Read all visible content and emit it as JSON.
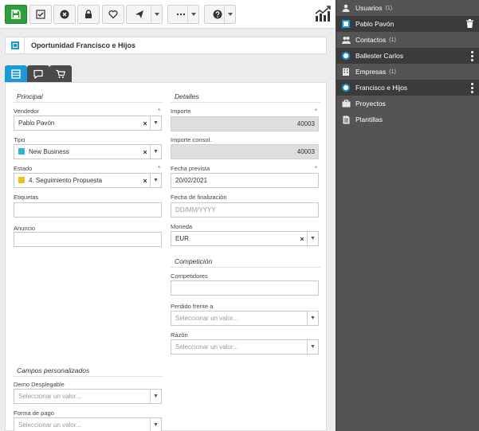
{
  "toolbar": {
    "buttons": [
      "save-icon",
      "check-icon",
      "cancel-circle-icon",
      "lock-icon",
      "heart-icon",
      "send-icon",
      "more-icon",
      "help-icon"
    ],
    "accent": "#2e9e3f"
  },
  "record": {
    "title": "Oportunidad Francisco e Hijos"
  },
  "tabs": [
    "form-icon",
    "comments-icon",
    "cart-icon"
  ],
  "form": {
    "principal": {
      "title": "Principal",
      "vendedor": {
        "label": "Vendedor",
        "value": "Pablo Pavón",
        "required": "*"
      },
      "tipo": {
        "label": "Tipo",
        "value": "New Business",
        "color": "#29b6d6"
      },
      "estado": {
        "label": "Estado",
        "value": "4. Seguimiento Propuesta",
        "color": "#e8c21a",
        "required": "*"
      },
      "etiquetas": {
        "label": "Etiquetas",
        "value": ""
      },
      "anuncio": {
        "label": "Anuncio",
        "value": ""
      }
    },
    "detalles": {
      "title": "Detalles",
      "importe": {
        "label": "Importe",
        "value": "40003",
        "required": "*"
      },
      "importe_consol": {
        "label": "Importe consol.",
        "value": "40003"
      },
      "fecha_prevista": {
        "label": "Fecha prevista",
        "value": "20/02/2021",
        "required": "*"
      },
      "fecha_finalizacion": {
        "label": "Fecha de finalización",
        "placeholder": "DD/MM/YYYY"
      },
      "moneda": {
        "label": "Moneda",
        "value": "EUR"
      }
    },
    "competicion": {
      "title": "Competición",
      "competidores": {
        "label": "Competidores",
        "value": ""
      },
      "perdido": {
        "label": "Perdido frente a",
        "placeholder": "Seleccionar un valor..."
      },
      "razon": {
        "label": "Razón",
        "placeholder": "Seleccionar un valor..."
      }
    },
    "personalizados": {
      "title": "Campos personalizados",
      "demo": {
        "label": "Demo Desplegable",
        "placeholder": "Seleccionar un valor..."
      },
      "forma_pago": {
        "label": "Forma de pago",
        "placeholder": "Seleccionar un valor..."
      }
    }
  },
  "sidebar": {
    "items": [
      {
        "label": "Usuarios",
        "count": "(1)",
        "icon": "user-icon"
      },
      {
        "label": "Pablo Pavón",
        "icon": "record-square-icon",
        "action": "trash-icon"
      },
      {
        "label": "Contactos",
        "count": "(1)",
        "icon": "contacts-icon"
      },
      {
        "label": "Ballester Carlos",
        "icon": "record-circle-icon",
        "action": "more-vertical-icon"
      },
      {
        "label": "Empresas",
        "count": "(1)",
        "icon": "company-icon"
      },
      {
        "label": "Francisco e Hijos",
        "icon": "record-circle-icon",
        "action": "more-vertical-icon"
      },
      {
        "label": "Proyectos",
        "icon": "briefcase-icon"
      },
      {
        "label": "Plantillas",
        "icon": "templates-icon"
      }
    ]
  }
}
